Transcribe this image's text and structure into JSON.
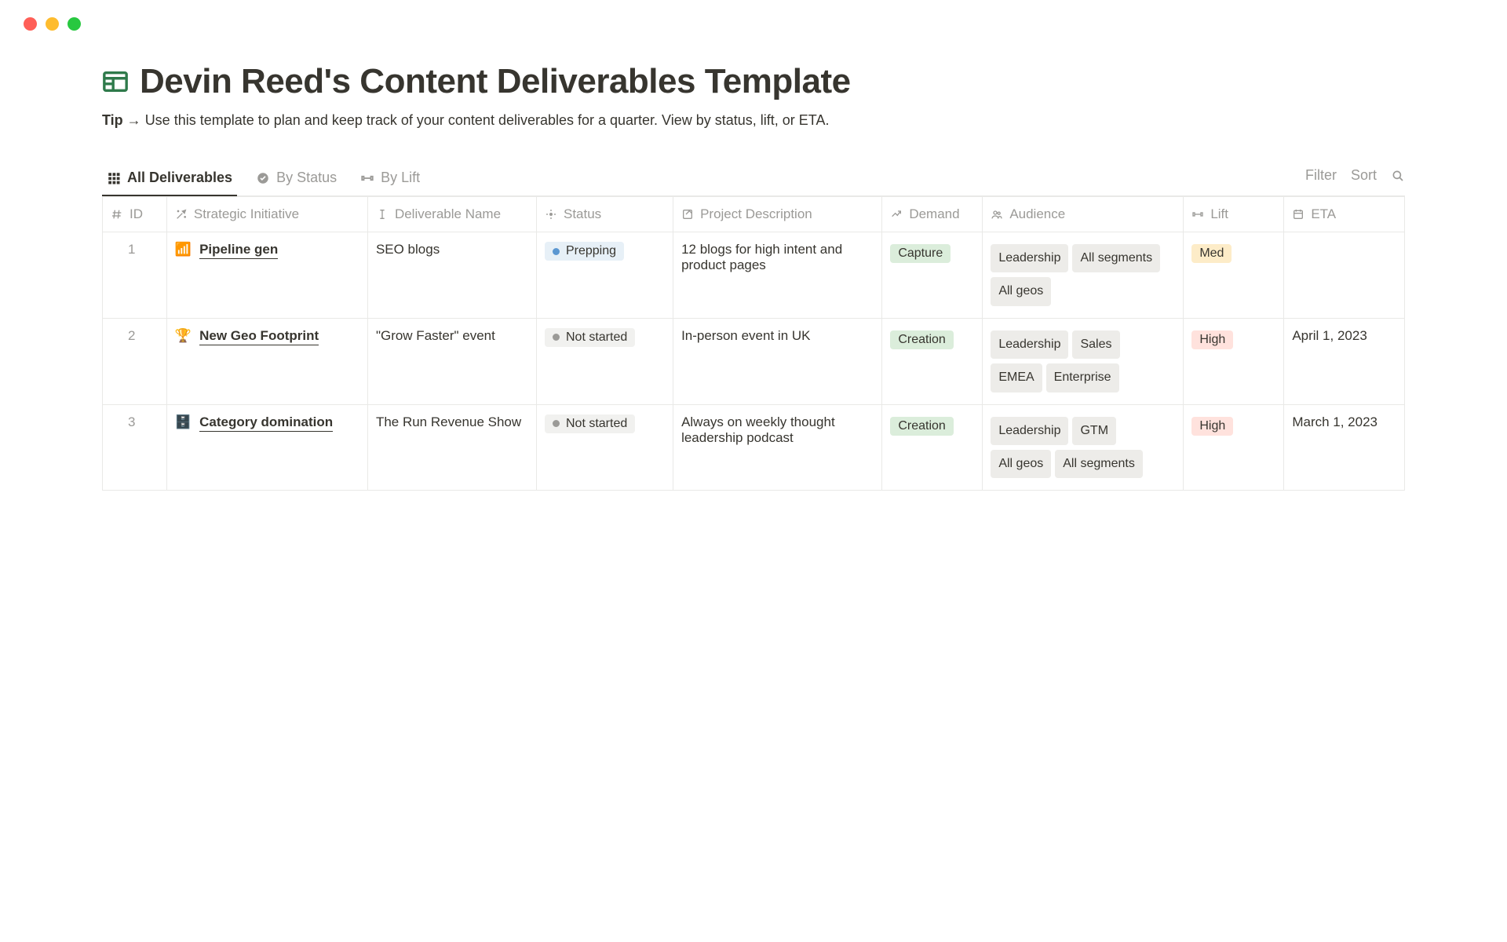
{
  "pageTitle": "Devin Reed's Content Deliverables Template",
  "tip": {
    "label": "Tip →",
    "text": "Use this template to plan and keep track of your content deliverables for a quarter. View by status, lift, or ETA."
  },
  "tabs": [
    {
      "label": "All Deliverables",
      "active": true,
      "icon": "grid"
    },
    {
      "label": "By Status",
      "active": false,
      "icon": "check-circle"
    },
    {
      "label": "By Lift",
      "active": false,
      "icon": "dumbbell"
    }
  ],
  "toolbar": {
    "filter": "Filter",
    "sort": "Sort"
  },
  "columns": {
    "id": "ID",
    "initiative": "Strategic Initiative",
    "name": "Deliverable Name",
    "status": "Status",
    "desc": "Project Description",
    "demand": "Demand",
    "audience": "Audience",
    "lift": "Lift",
    "eta": "ETA"
  },
  "rows": [
    {
      "id": "1",
      "initiativeEmoji": "📶",
      "initiative": "Pipeline gen",
      "name": "SEO blogs",
      "status": {
        "label": "Prepping",
        "variant": "blue"
      },
      "desc": "12 blogs for high intent and product pages",
      "demand": {
        "label": "Capture",
        "variant": "green"
      },
      "audience": [
        {
          "label": "Leadership",
          "variant": "gray"
        },
        {
          "label": "All segments",
          "variant": "gray"
        },
        {
          "label": "All geos",
          "variant": "gray"
        }
      ],
      "lift": {
        "label": "Med",
        "variant": "yellow"
      },
      "eta": ""
    },
    {
      "id": "2",
      "initiativeEmoji": "🏆",
      "initiative": "New Geo Footprint",
      "name": "\"Grow Faster\" event",
      "status": {
        "label": "Not started",
        "variant": "gray"
      },
      "desc": "In-person event in UK",
      "demand": {
        "label": "Creation",
        "variant": "green"
      },
      "audience": [
        {
          "label": "Leadership",
          "variant": "gray"
        },
        {
          "label": "Sales",
          "variant": "gray"
        },
        {
          "label": "EMEA",
          "variant": "gray"
        },
        {
          "label": "Enterprise",
          "variant": "gray"
        }
      ],
      "lift": {
        "label": "High",
        "variant": "red"
      },
      "eta": "April 1, 2023"
    },
    {
      "id": "3",
      "initiativeEmoji": "🗄️",
      "initiative": "Category domination",
      "name": "The Run Revenue Show",
      "status": {
        "label": "Not started",
        "variant": "gray"
      },
      "desc": "Always on weekly thought leadership podcast",
      "demand": {
        "label": "Creation",
        "variant": "green"
      },
      "audience": [
        {
          "label": "Leadership",
          "variant": "gray"
        },
        {
          "label": "GTM",
          "variant": "gray"
        },
        {
          "label": "All geos",
          "variant": "gray"
        },
        {
          "label": "All segments",
          "variant": "gray"
        }
      ],
      "lift": {
        "label": "High",
        "variant": "red"
      },
      "eta": "March 1, 2023"
    }
  ]
}
